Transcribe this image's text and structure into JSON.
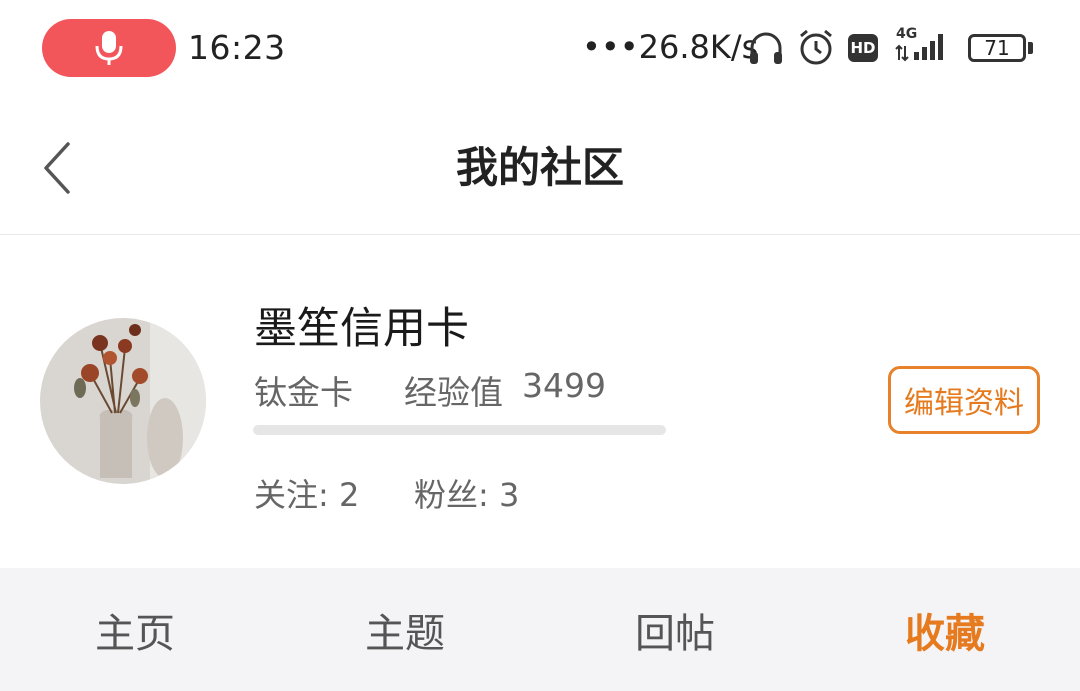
{
  "status_bar": {
    "time": "16:23",
    "network_speed": "•••26.8K/s",
    "hd_badge": "HD",
    "signal_type": "4G",
    "battery_level": "71",
    "icons": [
      "microphone-icon",
      "headset-icon",
      "alarm-icon",
      "hd-icon",
      "signal-icon",
      "battery-icon"
    ]
  },
  "header": {
    "title": "我的社区",
    "back_icon": "chevron-left-icon"
  },
  "profile": {
    "name": "墨笙信用卡",
    "level": "钛金卡",
    "experience_label": "经验值",
    "experience_value": "3499",
    "experience_progress": 0.0,
    "follow": "关注: 2",
    "fans": "粉丝: 3",
    "edit_button": "编辑资料"
  },
  "tabs": [
    {
      "label": "主页",
      "active": false
    },
    {
      "label": "主题",
      "active": false
    },
    {
      "label": "回帖",
      "active": false
    },
    {
      "label": "收藏",
      "active": true
    }
  ],
  "colors": {
    "accent": "#e57a1e",
    "mic_pill": "#f2555a",
    "tab_bar_bg": "#f4f4f6"
  }
}
